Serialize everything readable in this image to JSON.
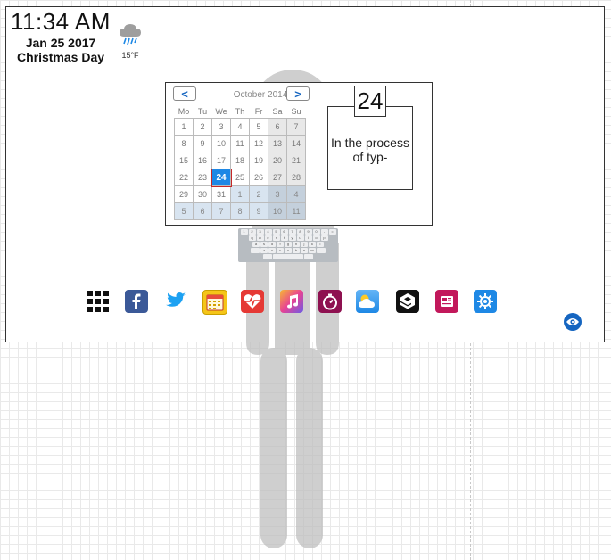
{
  "clock": {
    "time": "11:34 AM"
  },
  "date": {
    "line1": "Jan 25 2017",
    "line2": "Christmas Day"
  },
  "weather": {
    "icon": "rain-cloud-icon",
    "temp": "15°F"
  },
  "calendar": {
    "prev_label": "<",
    "next_label": ">",
    "month_label": "October 2014",
    "weekdays": [
      "Mo",
      "Tu",
      "We",
      "Th",
      "Fr",
      "Sa",
      "Su"
    ],
    "weeks": [
      [
        "1",
        "2",
        "3",
        "4",
        "5",
        "6",
        "7"
      ],
      [
        "8",
        "9",
        "10",
        "11",
        "12",
        "13",
        "14"
      ],
      [
        "15",
        "16",
        "17",
        "18",
        "19",
        "20",
        "21"
      ],
      [
        "22",
        "23",
        "24",
        "25",
        "26",
        "27",
        "28"
      ],
      [
        "29",
        "30",
        "31",
        "1",
        "2",
        "3",
        "4"
      ],
      [
        "5",
        "6",
        "7",
        "8",
        "9",
        "10",
        "11"
      ]
    ],
    "selected_day": "24"
  },
  "note": {
    "day": "24",
    "text": "In the process of typ-"
  },
  "keyboard": {
    "rows": [
      [
        "1",
        "2",
        "3",
        "4",
        "5",
        "6",
        "7",
        "8",
        "9",
        "0",
        "-",
        "="
      ],
      [
        "q",
        "w",
        "e",
        "r",
        "t",
        "y",
        "u",
        "i",
        "o",
        "p"
      ],
      [
        "a",
        "s",
        "d",
        "f",
        "g",
        "h",
        "j",
        "k",
        "l"
      ],
      [
        "z",
        "x",
        "c",
        "v",
        "b",
        "n",
        "m"
      ]
    ]
  },
  "dock": {
    "apps": [
      {
        "name": "apps-grid-icon"
      },
      {
        "name": "facebook-icon",
        "color": "#3b5998"
      },
      {
        "name": "twitter-icon",
        "color": "#1da1f2"
      },
      {
        "name": "calendar-icon",
        "color": "#f5c518"
      },
      {
        "name": "health-icon",
        "color": "#e53935"
      },
      {
        "name": "music-icon",
        "color": "#c239b3"
      },
      {
        "name": "timer-icon",
        "color": "#8e1150"
      },
      {
        "name": "weather-icon",
        "color": "#42a5f5"
      },
      {
        "name": "nine-gag-icon",
        "color": "#111111"
      },
      {
        "name": "news-icon",
        "color": "#c2185b"
      },
      {
        "name": "settings-icon",
        "color": "#1e88e5"
      }
    ]
  },
  "eye_button": {
    "icon": "eye-icon",
    "color": "#1565c0"
  }
}
